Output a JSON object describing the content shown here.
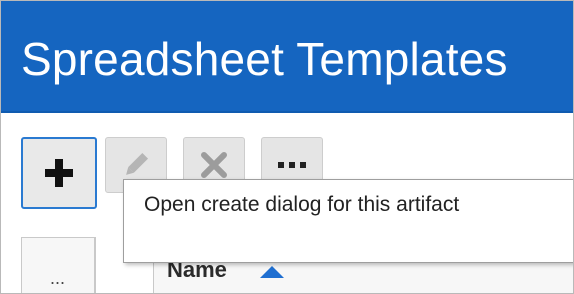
{
  "header": {
    "title": "Spreadsheet Templates"
  },
  "toolbar": {
    "add_icon": "plus-icon",
    "edit_icon": "pencil-icon",
    "delete_icon": "x-icon",
    "more_icon": "ellipsis-icon"
  },
  "tooltip": {
    "text": "Open create dialog for this artifact"
  },
  "grid": {
    "row_menu_label": "...",
    "columns": [
      {
        "label": "Name",
        "sort": "ascending"
      }
    ]
  },
  "colors": {
    "header_bg": "#1565c0",
    "accent": "#2a7ad1"
  }
}
